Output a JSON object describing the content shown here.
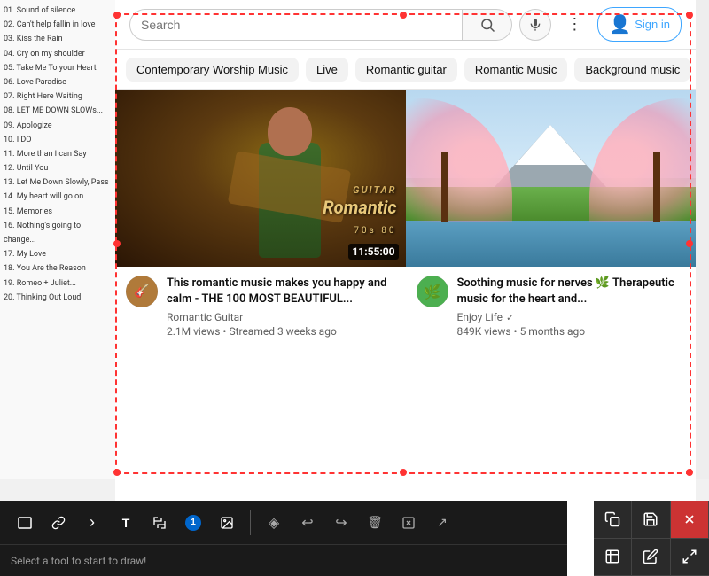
{
  "header": {
    "search_placeholder": "Search",
    "sign_in": "Sign in",
    "more_options": "⋮"
  },
  "filter_chips": [
    {
      "label": "Contemporary Worship Music",
      "active": false
    },
    {
      "label": "Live",
      "active": false
    },
    {
      "label": "Romantic guitar",
      "active": false
    },
    {
      "label": "Romantic Music",
      "active": false
    },
    {
      "label": "Background music",
      "active": false
    }
  ],
  "videos": [
    {
      "title": "This romantic music makes you happy and calm - THE 100 MOST BEAUTIFUL...",
      "channel": "Romantic Guitar",
      "verified": false,
      "views": "2.1M views",
      "uploaded": "Streamed 3 weeks ago",
      "duration": "11:55:00",
      "avatar_icon": "🎸"
    },
    {
      "title": "Soothing music for nerves 🌿 Therapeutic music for the heart and...",
      "channel": "Enjoy Life",
      "verified": true,
      "views": "849K views",
      "uploaded": "5 months ago",
      "avatar_icon": "🌿"
    }
  ],
  "tracklist": [
    "01. Sound of silence",
    "02. Can't help fallin in love",
    "03. Kiss the Rain",
    "04. Cry on my shoulder",
    "05. Take Me To your Heart",
    "06. Love Paradise",
    "07. Right Here Waiting",
    "08. LET ME DOWN SLOWs...",
    "09. Apologize",
    "10. I DO",
    "11. More than I can Say",
    "12. Until You",
    "13. Let Me Down Slowly, Pass",
    "14. My heart will go on",
    "15. Memories",
    "16. Nothing's going to change...",
    "17. My Love",
    "18. You Are the Reason",
    "19. Romeo + Juliet...",
    "20. Thinking Out Loud"
  ],
  "annotation": {
    "border_color": "#ff3333"
  },
  "toolbar": {
    "tools": [
      {
        "name": "rectangle-tool",
        "icon": "☐",
        "label": "Rectangle"
      },
      {
        "name": "link-tool",
        "icon": "🔗",
        "label": "Link"
      },
      {
        "name": "chevron-tool",
        "icon": "›",
        "label": "Chevron"
      },
      {
        "name": "text-tool",
        "icon": "T",
        "label": "Text"
      },
      {
        "name": "crop-tool",
        "icon": "✂",
        "label": "Crop"
      },
      {
        "name": "badge-tool",
        "icon": "①",
        "label": "Badge",
        "badge": "1"
      },
      {
        "name": "image-tool",
        "icon": "🖼",
        "label": "Image"
      }
    ],
    "right_tools": [
      {
        "name": "fill-tool",
        "icon": "◈",
        "label": "Fill"
      },
      {
        "name": "undo-tool",
        "icon": "↩",
        "label": "Undo"
      },
      {
        "name": "redo-tool",
        "icon": "↪",
        "label": "Redo"
      },
      {
        "name": "delete-tool",
        "icon": "🗑",
        "label": "Delete"
      },
      {
        "name": "delete-alt-tool",
        "icon": "⊡",
        "label": "Delete Alt"
      },
      {
        "name": "send-tool",
        "icon": "↗",
        "label": "Send"
      }
    ],
    "status_text": "Select a tool to start to draw!"
  },
  "right_panel_buttons": [
    {
      "name": "copy-btn",
      "icon": "⧉",
      "label": "Copy"
    },
    {
      "name": "save-btn",
      "icon": "💾",
      "label": "Save"
    },
    {
      "name": "close-btn",
      "icon": "✕",
      "label": "Close"
    },
    {
      "name": "crop-panel-btn",
      "icon": "⊡",
      "label": "Crop Panel"
    },
    {
      "name": "edit-btn",
      "icon": "✏",
      "label": "Edit"
    },
    {
      "name": "expand-btn",
      "icon": "⛶",
      "label": "Expand"
    }
  ]
}
